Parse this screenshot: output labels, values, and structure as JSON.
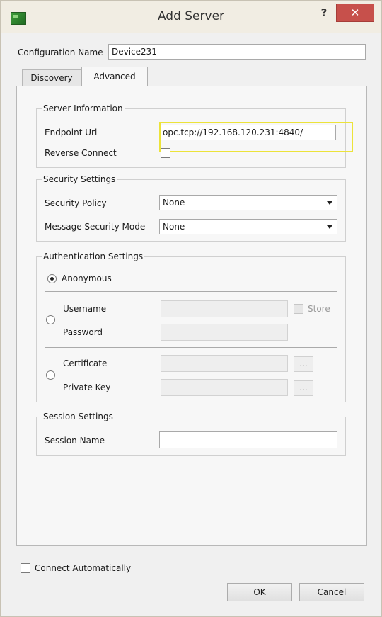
{
  "window": {
    "title": "Add Server",
    "help_label": "?",
    "close_label": "✕"
  },
  "config": {
    "label": "Configuration Name",
    "value": "Device231"
  },
  "tabs": [
    {
      "label": "Discovery"
    },
    {
      "label": "Advanced"
    }
  ],
  "server_info": {
    "title": "Server Information",
    "endpoint_label": "Endpoint Url",
    "endpoint_value": "opc.tcp://192.168.120.231:4840/",
    "reverse_label": "Reverse Connect"
  },
  "security": {
    "title": "Security Settings",
    "policy_label": "Security Policy",
    "policy_value": "None",
    "mode_label": "Message Security Mode",
    "mode_value": "None"
  },
  "auth": {
    "title": "Authentication Settings",
    "anonymous_label": "Anonymous",
    "username_label": "Username",
    "store_label": "Store",
    "password_label": "Password",
    "certificate_label": "Certificate",
    "private_key_label": "Private Key",
    "browse_label": "..."
  },
  "session": {
    "title": "Session Settings",
    "name_label": "Session Name",
    "name_value": ""
  },
  "footer": {
    "connect_auto_label": "Connect Automatically",
    "ok_label": "OK",
    "cancel_label": "Cancel"
  }
}
